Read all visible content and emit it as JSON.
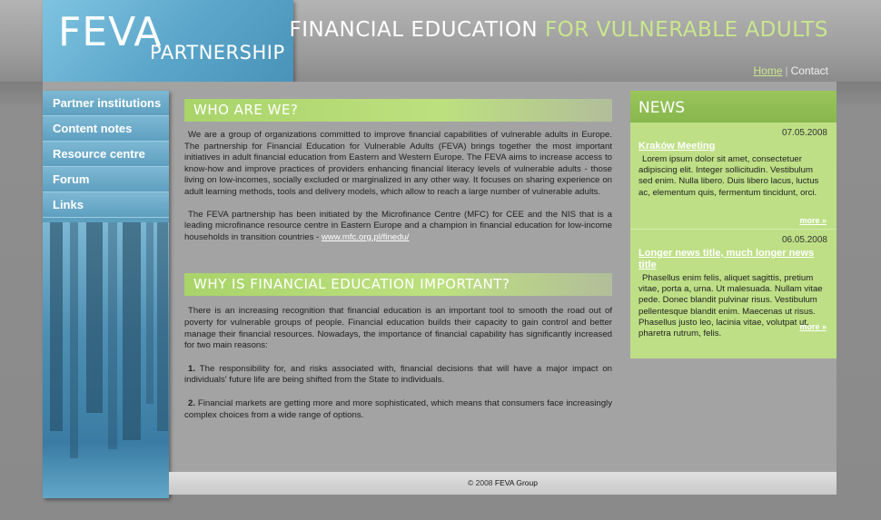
{
  "header": {
    "logo_main": "FEVA",
    "logo_sub": "PARTNERSHIP",
    "tagline_part1": "FINANCIAL EDUCATION",
    "tagline_part2": "FOR VULNERABLE ADULTS",
    "nav": {
      "home": "Home",
      "separator": "|",
      "contact": "Contact"
    }
  },
  "sidebar": {
    "items": [
      {
        "label": "Partner institutions"
      },
      {
        "label": "Content notes"
      },
      {
        "label": "Resource centre"
      },
      {
        "label": "Forum"
      },
      {
        "label": "Links"
      }
    ]
  },
  "main": {
    "section1": {
      "title": "WHO ARE WE?",
      "p1": "We are a group of organizations committed to improve financial capabilities of vulnerable adults in Europe. The partnership for Financial Education for Vulnerable Adults (FEVA) brings together the most important initiatives in adult financial education from Eastern and Western Europe. The FEVA aims to increase access to know-how and improve practices of providers enhancing financial literacy levels of vulnerable adults - those living on low-incomes, socially excluded or marginalized in any other way. It focuses on sharing experience on adult learning methods, tools and delivery models, which allow to reach a large number of vulnerable adults.",
      "p2": "The FEVA partnership has been initiated by the Microfinance Centre (MFC) for CEE and the NIS that is a leading microfinance resource centre in Eastern Europe and a champion in financial education for low-income households in transition countries -",
      "link": "www.mfc.org.pl/finedu/"
    },
    "section2": {
      "title": "WHY IS FINANCIAL EDUCATION IMPORTANT?",
      "p1": "There is an increasing recognition that financial education is an important tool to smooth the road out of poverty for vulnerable groups of people. Financial education builds their capacity to gain control and better manage their financial resources. Nowadays, the importance of financial capability has significantly increased for two main reasons:",
      "r1_num": "1.",
      "r1": "The responsibility for, and risks associated with, financial decisions that will have a major impact on individuals' future life are being shifted from the State to individuals.",
      "r2_num": "2.",
      "r2": "Financial markets are getting more and more sophisticated, which means that consumers face increasingly complex choices from a wide range of options."
    }
  },
  "news": {
    "title": "NEWS",
    "items": [
      {
        "date": "07.05.2008",
        "headline": "Kraków Meeting",
        "body": "Lorem ipsum dolor sit amet, consectetuer adipiscing elit. Integer sollicitudin. Vestibulum sed enim. Nulla libero. Duis libero lacus, luctus ac, elementum quis, fermentum tincidunt, orci.",
        "more": "more »"
      },
      {
        "date": "06.05.2008",
        "headline": "Longer news title, much longer news title",
        "body": "Phasellus enim felis, aliquet sagittis, pretium vitae, porta a, urna. Ut malesuada. Nullam vitae pede. Donec blandit pulvinar risus. Vestibulum pellentesque blandit enim. Maecenas ut risus. Phasellus justo leo, lacinia vitae, volutpat ut, pharetra rutrum, felis.",
        "more": "more »"
      }
    ]
  },
  "footer": {
    "copyright": "© 2008",
    "owner": "FEVA Group"
  },
  "colors": {
    "accent_green": "#bedf86",
    "accent_blue": "#5aa5c9"
  }
}
